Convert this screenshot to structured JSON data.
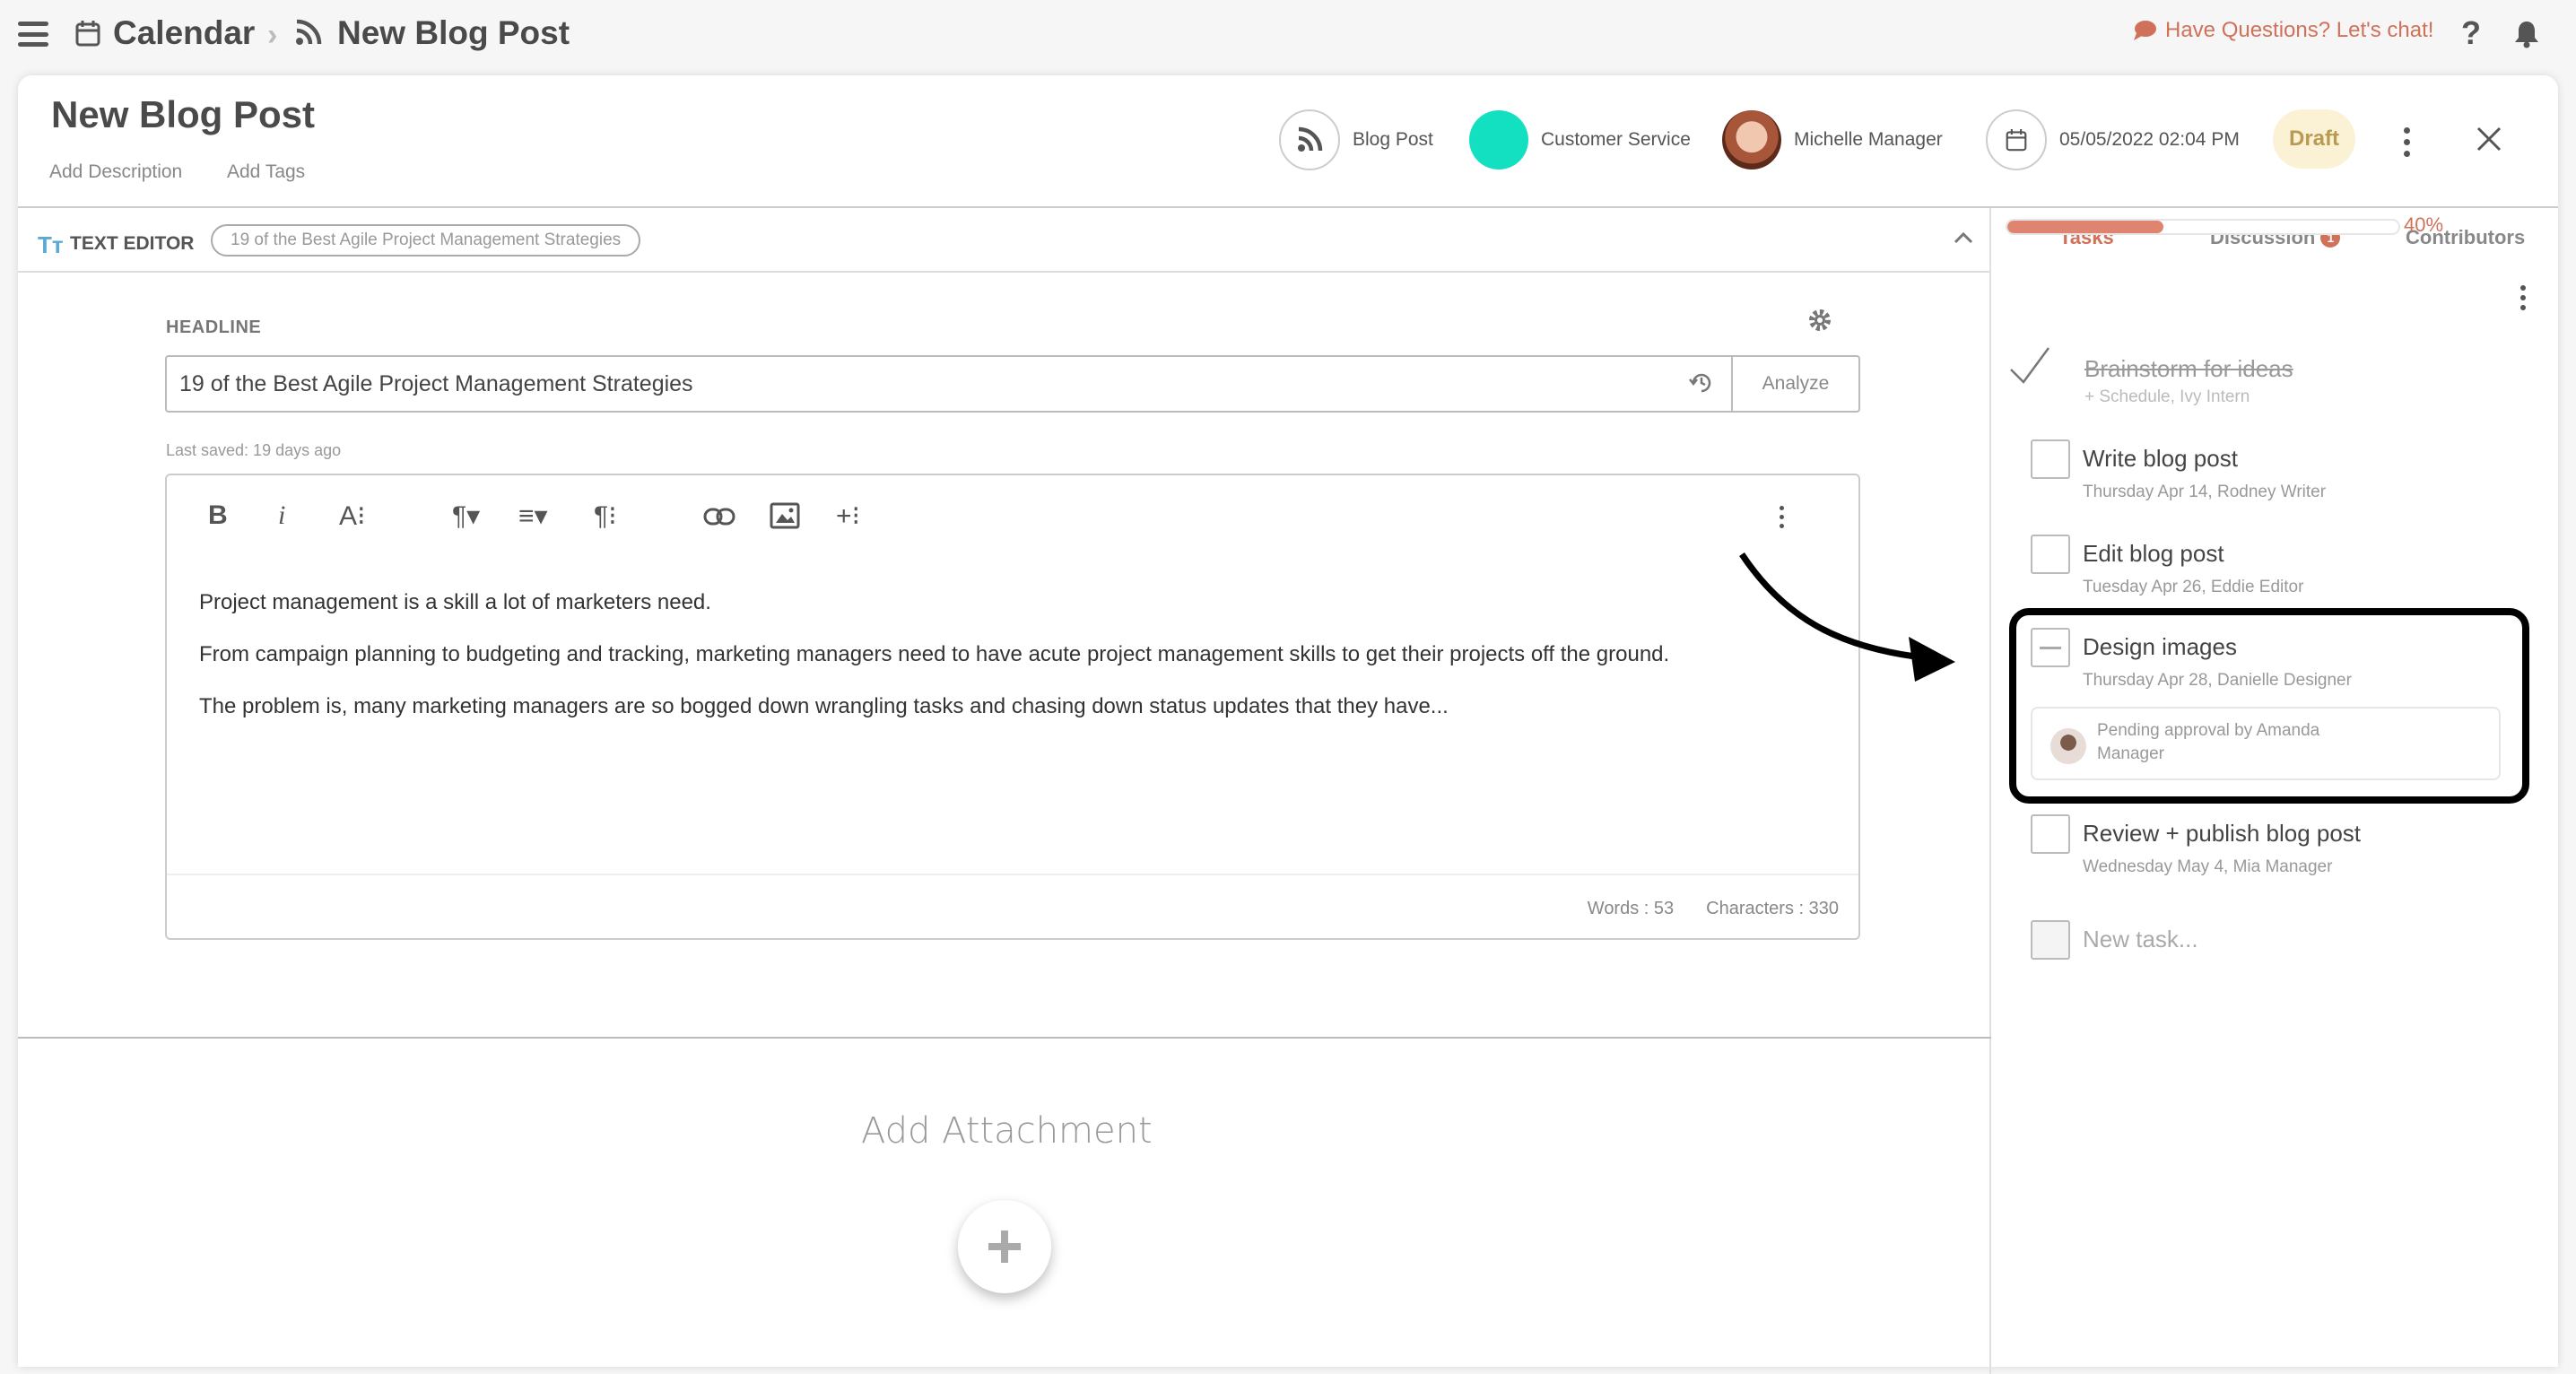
{
  "topbar": {
    "breadcrumb": [
      {
        "label": "Calendar",
        "icon": "calendar-icon"
      },
      {
        "label": "New Blog Post",
        "icon": "rss-icon"
      }
    ],
    "chat_label": "Have Questions? Let's chat!",
    "help_label": "?"
  },
  "header": {
    "title": "New Blog Post",
    "add_description": "Add Description",
    "add_tags": "Add Tags",
    "content_type": "Blog Post",
    "team": "Customer Service",
    "team_color": "#13e0c0",
    "owner": "Michelle Manager",
    "datetime": "05/05/2022 02:04 PM",
    "status": "Draft"
  },
  "text_editor": {
    "label": "TEXT EDITOR",
    "icon_glyph": "Tт",
    "pill": "19 of the Best Agile Project Management Strategies",
    "headline_label": "HEADLINE",
    "headline_value": "19 of the Best Agile Project Management Strategies",
    "analyze_label": "Analyze",
    "last_saved": "Last saved: 19 days ago",
    "toolbar": {
      "bold": "B",
      "italic": "i",
      "font_size": "A⁝",
      "paragraph": "¶▾",
      "align": "≡▾",
      "paragraph_more": "¶⁝",
      "insert_more": "+⁝"
    },
    "paragraphs": [
      "Project management is a skill a lot of marketers need.",
      "From campaign planning to budgeting and tracking, marketing managers need to have acute project management skills to get their projects off the ground.",
      "The problem is, many marketing managers are so bogged down wrangling tasks and chasing down status updates that they have..."
    ],
    "words": "Words : 53",
    "characters": "Characters : 330"
  },
  "attachment": {
    "title": "Add Attachment",
    "button": "+"
  },
  "sidebar": {
    "tabs": [
      {
        "label": "Tasks",
        "active": true
      },
      {
        "label": "Discussion",
        "badge": "1"
      },
      {
        "label": "Contributors"
      }
    ],
    "progress_percent": 40,
    "progress_label": "40%",
    "accent_color": "#d0715a",
    "tasks": [
      {
        "title": "Brainstorm for ideas",
        "meta": "+ Schedule,  Ivy Intern",
        "state": "done"
      },
      {
        "title": "Write blog post",
        "meta": "Thursday Apr 14,  Rodney Writer",
        "state": "open"
      },
      {
        "title": "Edit blog post",
        "meta": "Tuesday Apr 26,  Eddie Editor",
        "state": "open"
      },
      {
        "title": "Design images",
        "meta": "Thursday Apr 28,  Danielle Designer",
        "state": "pending",
        "approval": "Pending approval by Amanda Manager"
      },
      {
        "title": "Review + publish blog post",
        "meta": "Wednesday May 4,  Mia Manager",
        "state": "open"
      }
    ],
    "new_task_placeholder": "New task..."
  }
}
